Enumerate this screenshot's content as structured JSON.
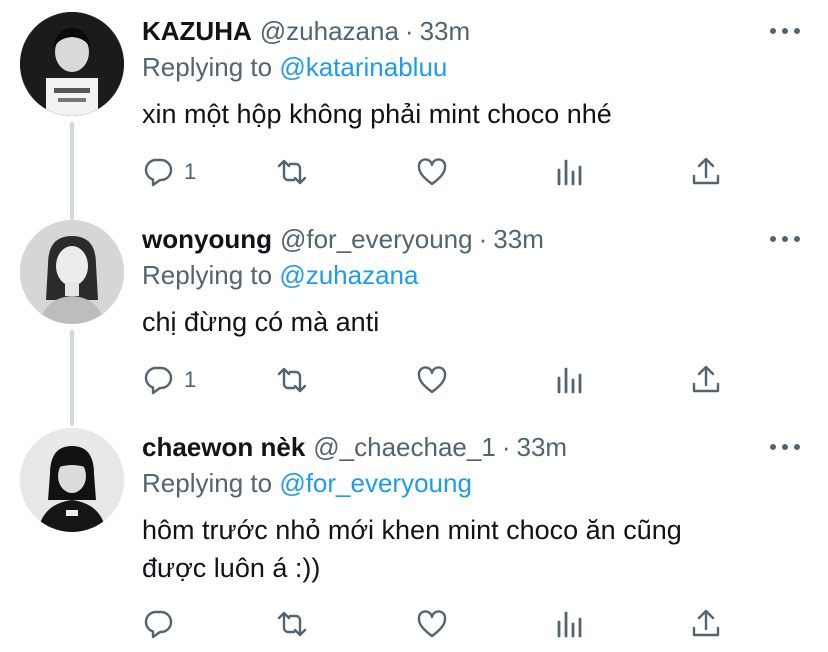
{
  "tweets": [
    {
      "name": "KAZUHA",
      "handle": "@zuhazana",
      "separator": "·",
      "time": "33m",
      "replying_prefix": "Replying to",
      "replying_to": "@katarinabluu",
      "text": "xin một hộp không phải mint choco nhé",
      "reply_count": "1"
    },
    {
      "name": "wonyoung",
      "handle": "@for_everyoung",
      "separator": "·",
      "time": "33m",
      "replying_prefix": "Replying to",
      "replying_to": "@zuhazana",
      "text": "chị đừng có mà anti",
      "reply_count": "1"
    },
    {
      "name": "chaewon nèk",
      "handle": "@_chaechae_1",
      "separator": "·",
      "time": "33m",
      "replying_prefix": "Replying to",
      "replying_to": "@for_everyoung",
      "text": "hôm trước nhỏ mới khen mint choco ăn cũng được luôn á :))",
      "reply_count": ""
    }
  ],
  "icons": [
    "reply-icon",
    "retweet-icon",
    "like-icon",
    "analytics-icon",
    "share-icon",
    "more-icon"
  ],
  "colors": {
    "text": "#0f1419",
    "secondary": "#536471",
    "link": "#1d9bf0",
    "thread_line": "#cfd9de"
  }
}
